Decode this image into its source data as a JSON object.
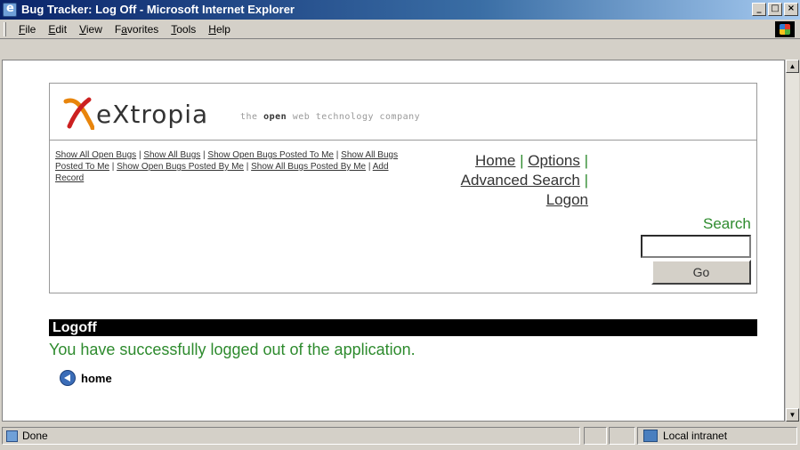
{
  "window": {
    "title": "Bug Tracker: Log Off - Microsoft Internet Explorer"
  },
  "menu": [
    {
      "pre": "",
      "ul": "F",
      "post": "ile"
    },
    {
      "pre": "",
      "ul": "E",
      "post": "dit"
    },
    {
      "pre": "",
      "ul": "V",
      "post": "iew"
    },
    {
      "pre": "F",
      "ul": "a",
      "post": "vorites"
    },
    {
      "pre": "",
      "ul": "T",
      "post": "ools"
    },
    {
      "pre": "",
      "ul": "H",
      "post": "elp"
    }
  ],
  "logo": {
    "word": "eXtropia",
    "tag_pre": "the ",
    "tag_bold": "open",
    "tag_post": " web technology company"
  },
  "quicklinks": [
    "Show All Open Bugs",
    "Show All Bugs",
    "Show Open Bugs Posted To Me",
    "Show All Bugs Posted To Me",
    "Show Open Bugs Posted By Me",
    "Show All Bugs Posted By Me",
    "Add Record"
  ],
  "nav": {
    "home": "Home",
    "options": "Options",
    "advanced_search": "Advanced Search",
    "logon": "Logon"
  },
  "search": {
    "label": "Search",
    "value": "",
    "button": "Go"
  },
  "section": {
    "title": "Logoff",
    "message": "You have successfully logged out of the application.",
    "home_link": "home"
  },
  "status": {
    "text": "Done",
    "zone": "Local intranet"
  },
  "colors": {
    "accent_green": "#2e8b2e",
    "title_blue": "#0a246a"
  }
}
